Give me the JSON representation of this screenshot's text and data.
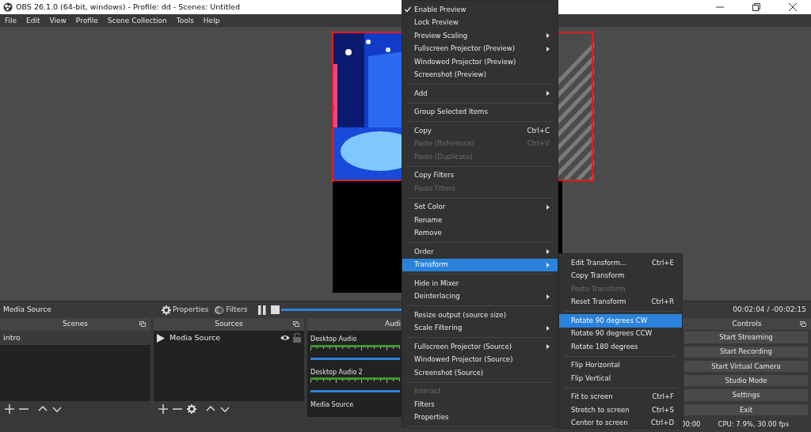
{
  "window": {
    "title": "OBS 26.1.0 (64-bit, windows) - Profile: dd - Scenes: Untitled"
  },
  "menu_bar": [
    "File",
    "Edit",
    "View",
    "Profile",
    "Scene Collection",
    "Tools",
    "Help"
  ],
  "source_toolbar": {
    "source_name": "Media Source",
    "buttons": [
      {
        "kind": "properties",
        "label": "Properties"
      },
      {
        "kind": "filters",
        "label": "Filters"
      }
    ],
    "seek": {
      "level": 0.48
    },
    "time": "00:02:04 / -00:02:15"
  },
  "scenes": {
    "title": "Scenes",
    "items": [
      {
        "label": "intro",
        "selected": true
      }
    ]
  },
  "sources": {
    "title": "Sources",
    "items": [
      {
        "label": "Media Source",
        "visible": true,
        "locked": false
      }
    ]
  },
  "audio_mixer": {
    "title": "Audi",
    "channels": [
      {
        "name": "Desktop Audio",
        "kind": "meter"
      },
      {
        "name": "Desktop Audio 2",
        "kind": "meter"
      },
      {
        "name": "Media Source",
        "kind": "label"
      }
    ]
  },
  "controls": {
    "title": "Controls",
    "buttons": [
      "Start Streaming",
      "Start Recording",
      "Start Virtual Camera",
      "Studio Mode",
      "Settings",
      "Exit"
    ]
  },
  "status_bar": {
    "time": "00:00",
    "cpu": "CPU: 7.9%, 30.00 fps"
  },
  "context_menu": {
    "items": [
      {
        "kind": "item",
        "label": "Enable Preview",
        "checked": true,
        "disabled": false,
        "selected": false
      },
      {
        "kind": "item",
        "label": "Lock Preview",
        "checked": false,
        "disabled": false,
        "selected": false
      },
      {
        "kind": "item",
        "label": "Preview Scaling",
        "submenu": true,
        "checked": false,
        "disabled": false,
        "selected": false
      },
      {
        "kind": "item",
        "label": "Fullscreen Projector (Preview)",
        "submenu": true,
        "checked": false,
        "disabled": false,
        "selected": false
      },
      {
        "kind": "item",
        "label": "Windowed Projector (Preview)",
        "checked": false,
        "disabled": false,
        "selected": false
      },
      {
        "kind": "item",
        "label": "Screenshot (Preview)",
        "checked": false,
        "disabled": false,
        "selected": false
      },
      {
        "kind": "separator"
      },
      {
        "kind": "item",
        "label": "Add",
        "submenu": true,
        "checked": false,
        "disabled": false,
        "selected": false
      },
      {
        "kind": "separator"
      },
      {
        "kind": "item",
        "label": "Group Selected Items",
        "checked": false,
        "disabled": false,
        "selected": false
      },
      {
        "kind": "separator"
      },
      {
        "kind": "item",
        "label": "Copy",
        "shortcut": "Ctrl+C",
        "checked": false,
        "disabled": false,
        "selected": false
      },
      {
        "kind": "item",
        "label": "Paste (Reference)",
        "shortcut": "Ctrl+V",
        "checked": false,
        "disabled": true,
        "selected": false
      },
      {
        "kind": "item",
        "label": "Paste (Duplicate)",
        "checked": false,
        "disabled": true,
        "selected": false
      },
      {
        "kind": "separator"
      },
      {
        "kind": "item",
        "label": "Copy Filters",
        "checked": false,
        "disabled": false,
        "selected": false
      },
      {
        "kind": "item",
        "label": "Paste Filters",
        "checked": false,
        "disabled": true,
        "selected": false
      },
      {
        "kind": "separator"
      },
      {
        "kind": "item",
        "label": "Set Color",
        "submenu": true,
        "checked": false,
        "disabled": false,
        "selected": false
      },
      {
        "kind": "item",
        "label": "Rename",
        "checked": false,
        "disabled": false,
        "selected": false
      },
      {
        "kind": "item",
        "label": "Remove",
        "checked": false,
        "disabled": false,
        "selected": false
      },
      {
        "kind": "separator"
      },
      {
        "kind": "item",
        "label": "Order",
        "submenu": true,
        "checked": false,
        "disabled": false,
        "selected": false
      },
      {
        "kind": "item",
        "label": "Transform",
        "submenu": true,
        "checked": false,
        "disabled": false,
        "selected": true
      },
      {
        "kind": "separator"
      },
      {
        "kind": "item",
        "label": "Hide in Mixer",
        "checked": false,
        "disabled": false,
        "selected": false
      },
      {
        "kind": "item",
        "label": "Deinterlacing",
        "submenu": true,
        "checked": false,
        "disabled": false,
        "selected": false
      },
      {
        "kind": "separator"
      },
      {
        "kind": "item",
        "label": "Resize output (source size)",
        "checked": false,
        "disabled": false,
        "selected": false
      },
      {
        "kind": "item",
        "label": "Scale Filtering",
        "submenu": true,
        "checked": false,
        "disabled": false,
        "selected": false
      },
      {
        "kind": "separator"
      },
      {
        "kind": "item",
        "label": "Fullscreen Projector (Source)",
        "submenu": true,
        "checked": false,
        "disabled": false,
        "selected": false
      },
      {
        "kind": "item",
        "label": "Windowed Projector (Source)",
        "checked": false,
        "disabled": false,
        "selected": false
      },
      {
        "kind": "item",
        "label": "Screenshot (Source)",
        "checked": false,
        "disabled": false,
        "selected": false
      },
      {
        "kind": "separator"
      },
      {
        "kind": "item",
        "label": "Interact",
        "checked": false,
        "disabled": true,
        "selected": false
      },
      {
        "kind": "item",
        "label": "Filters",
        "checked": false,
        "disabled": false,
        "selected": false
      },
      {
        "kind": "item",
        "label": "Properties",
        "checked": false,
        "disabled": false,
        "selected": false
      },
      {
        "kind": "separator"
      }
    ]
  },
  "transform_menu": {
    "items": [
      {
        "kind": "item",
        "label": "Edit Transform...",
        "shortcut": "Ctrl+E",
        "disabled": false,
        "selected": false
      },
      {
        "kind": "item",
        "label": "Copy Transform",
        "disabled": false,
        "selected": false
      },
      {
        "kind": "item",
        "label": "Paste Transform",
        "disabled": true,
        "selected": false
      },
      {
        "kind": "item",
        "label": "Reset Transform",
        "shortcut": "Ctrl+R",
        "disabled": false,
        "selected": false
      },
      {
        "kind": "separator"
      },
      {
        "kind": "item",
        "label": "Rotate 90 degrees CW",
        "disabled": false,
        "selected": true
      },
      {
        "kind": "item",
        "label": "Rotate 90 degrees CCW",
        "disabled": false,
        "selected": false
      },
      {
        "kind": "item",
        "label": "Rotate 180 degrees",
        "disabled": false,
        "selected": false
      },
      {
        "kind": "separator"
      },
      {
        "kind": "item",
        "label": "Flip Horizontal",
        "disabled": false,
        "selected": false
      },
      {
        "kind": "item",
        "label": "Flip Vertical",
        "disabled": false,
        "selected": false
      },
      {
        "kind": "separator"
      },
      {
        "kind": "item",
        "label": "Fit to screen",
        "shortcut": "Ctrl+F",
        "disabled": false,
        "selected": false
      },
      {
        "kind": "item",
        "label": "Stretch to screen",
        "shortcut": "Ctrl+S",
        "disabled": false,
        "selected": false
      },
      {
        "kind": "item",
        "label": "Center to screen",
        "shortcut": "Ctrl+D",
        "disabled": false,
        "selected": false
      }
    ]
  }
}
